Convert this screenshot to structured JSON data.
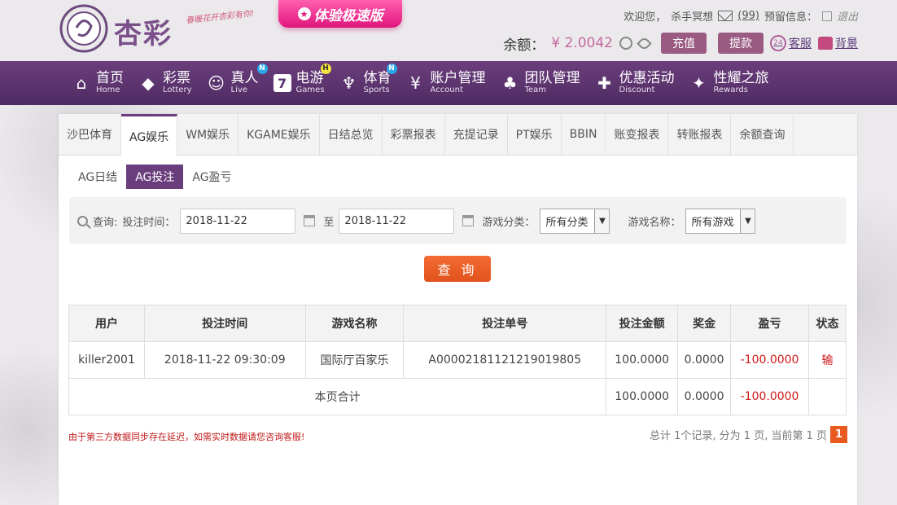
{
  "brand": {
    "name": "杏彩",
    "slogan": "春暖花开杏彩有你!",
    "promo": "体验极速版"
  },
  "topbar": {
    "welcome": "欢迎您，",
    "username": "杀手冥想",
    "messages": "(99)",
    "reserve_label": "预留信息：",
    "logout": "退出",
    "balance_label": "余额：",
    "balance_value": "¥ 2.0042",
    "deposit": "充值",
    "withdraw": "提款",
    "service": "客服",
    "background": "背景"
  },
  "nav": [
    {
      "cn": "首页",
      "en": "Home",
      "icon": "⌂",
      "badge": ""
    },
    {
      "cn": "彩票",
      "en": "Lottery",
      "icon": "◆",
      "badge": ""
    },
    {
      "cn": "真人",
      "en": "Live",
      "icon": "☺",
      "badge": "N"
    },
    {
      "cn": "电游",
      "en": "Games",
      "icon": "7",
      "badge": "H"
    },
    {
      "cn": "体育",
      "en": "Sports",
      "icon": "♆",
      "badge": "N"
    },
    {
      "cn": "账户管理",
      "en": "Account",
      "icon": "¥",
      "badge": ""
    },
    {
      "cn": "团队管理",
      "en": "Team",
      "icon": "♣",
      "badge": ""
    },
    {
      "cn": "优惠活动",
      "en": "Discount",
      "icon": "✚",
      "badge": ""
    },
    {
      "cn": "性耀之旅",
      "en": "Rewards",
      "icon": "✦",
      "badge": ""
    }
  ],
  "tabs": [
    "沙巴体育",
    "AG娱乐",
    "WM娱乐",
    "KGAME娱乐",
    "日结总览",
    "彩票报表",
    "充提记录",
    "PT娱乐",
    "BBIN",
    "账变报表",
    "转账报表",
    "余额查询"
  ],
  "active_tab": 1,
  "subtabs": [
    "AG日结",
    "AG投注",
    "AG盈亏"
  ],
  "active_subtab": 1,
  "query": {
    "label": "查询:",
    "time_label": "投注时间：",
    "start_date": "2018-11-22",
    "to": "至",
    "end_date": "2018-11-22",
    "category_label": "游戏分类：",
    "category_value": "所有分类",
    "game_label": "游戏名称：",
    "game_value": "所有游戏",
    "button": "查 询"
  },
  "table": {
    "headers": [
      "用户",
      "投注时间",
      "游戏名称",
      "投注单号",
      "投注金额",
      "奖金",
      "盈亏",
      "状态"
    ],
    "row": [
      "killer2001",
      "2018-11-22 09:30:09",
      "国际厅百家乐",
      "A00002181121219019805",
      "100.0000",
      "0.0000",
      "-100.0000",
      "输"
    ],
    "summary": {
      "label": "本页合计",
      "amount": "100.0000",
      "bonus": "0.0000",
      "profit": "-100.0000"
    }
  },
  "footer": {
    "note": "由于第三方数据同步存在延迟，如需实时数据请您咨询客服!",
    "pager_text": "总计 1个记录, 分为 1 页, 当前第 1 页",
    "page": "1"
  }
}
